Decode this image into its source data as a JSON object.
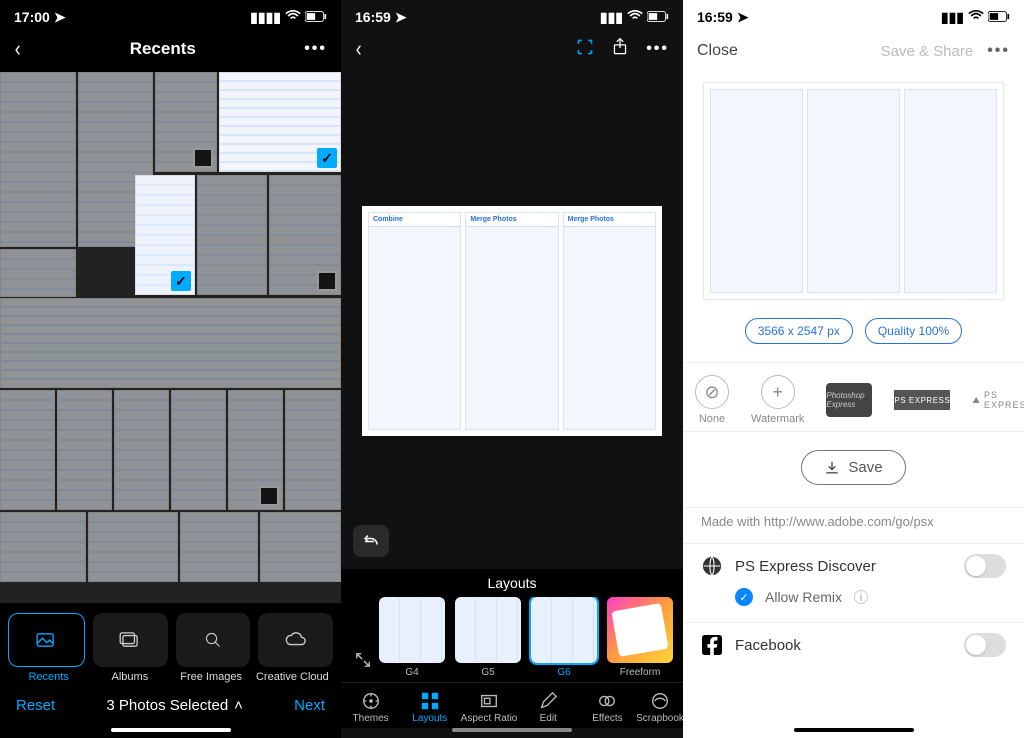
{
  "screen1": {
    "status": {
      "time": "17:00"
    },
    "header": {
      "title": "Recents"
    },
    "tabs": [
      {
        "label": "Recents",
        "active": true
      },
      {
        "label": "Albums"
      },
      {
        "label": "Free Images"
      },
      {
        "label": "Creative Cloud"
      }
    ],
    "footer": {
      "reset": "Reset",
      "count": "3 Photos Selected",
      "next": "Next"
    }
  },
  "screen2": {
    "status": {
      "time": "16:59"
    },
    "panel": {
      "c1": "Combine",
      "c2": "Merge Photos",
      "c3": "Merge Photos"
    },
    "layouts": {
      "title": "Layouts",
      "items": [
        {
          "label": "G4"
        },
        {
          "label": "G5"
        },
        {
          "label": "G6",
          "selected": true
        },
        {
          "label": "Freeform"
        }
      ]
    },
    "tabs": [
      {
        "label": "Themes"
      },
      {
        "label": "Layouts",
        "active": true
      },
      {
        "label": "Aspect Ratio"
      },
      {
        "label": "Edit"
      },
      {
        "label": "Effects"
      },
      {
        "label": "Scrapbook"
      }
    ]
  },
  "screen3": {
    "status": {
      "time": "16:59"
    },
    "header": {
      "close": "Close",
      "save": "Save & Share"
    },
    "pills": {
      "dims": "3566 x 2547 px",
      "quality": "Quality 100%"
    },
    "watermark": {
      "none": "None",
      "wm": "Watermark",
      "badge": "Photoshop Express",
      "ps1": "PS EXPRESS",
      "ps2": "PS EXPRESS"
    },
    "saveBtn": "Save",
    "madeWith": "Made with http://www.adobe.com/go/psx",
    "share": {
      "discover": "PS Express Discover",
      "remix": "Allow Remix",
      "facebook": "Facebook"
    }
  }
}
